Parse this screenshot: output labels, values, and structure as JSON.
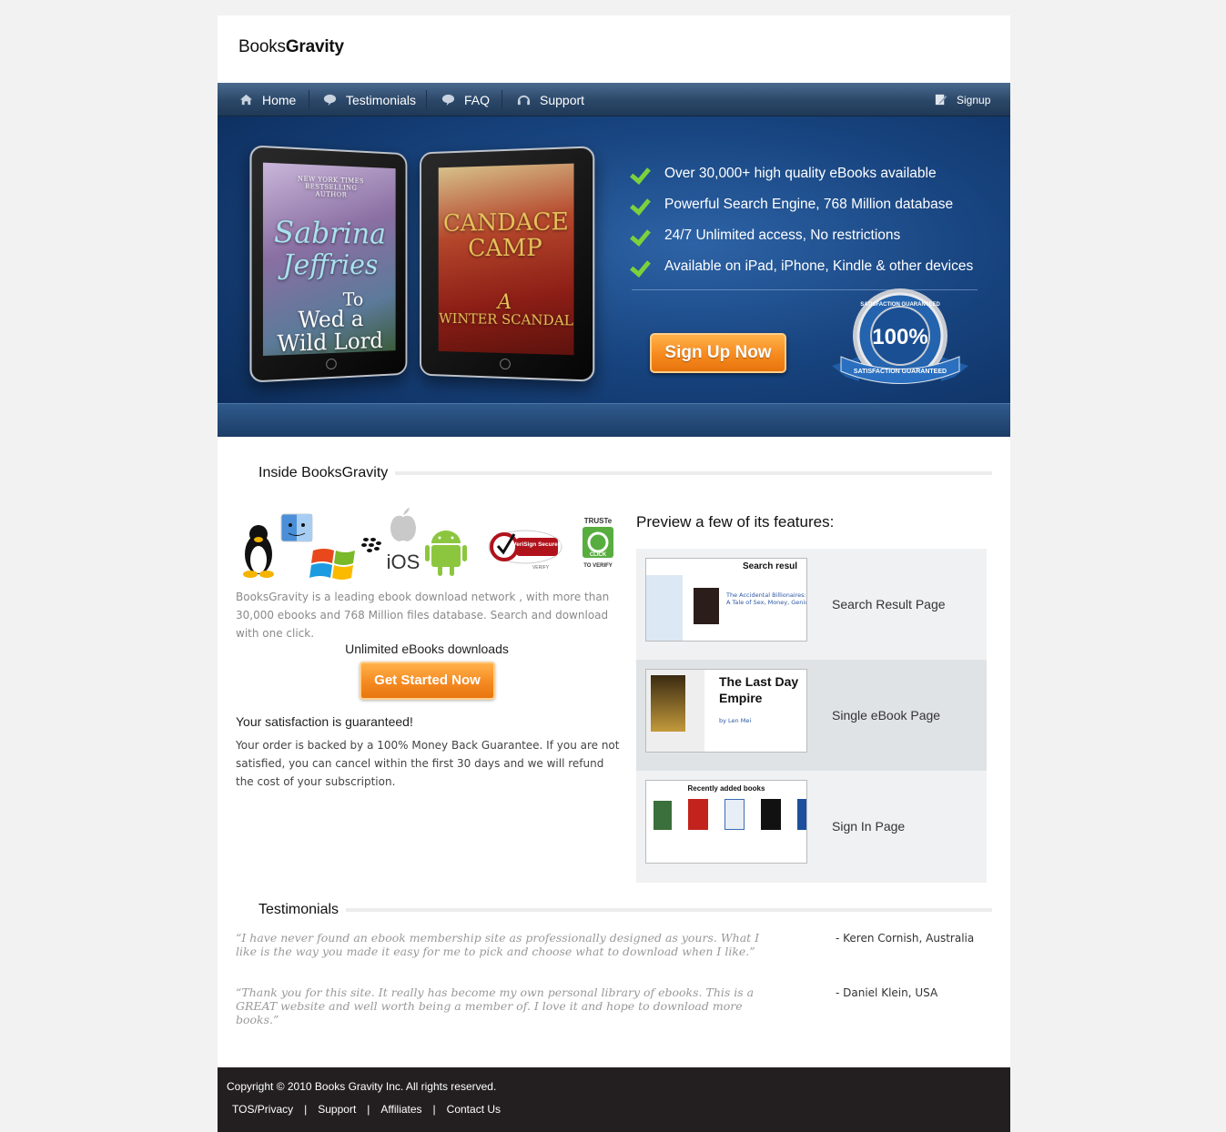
{
  "logo": {
    "light": "Books",
    "bold": "Gravity"
  },
  "nav": {
    "items": [
      {
        "label": "Home",
        "icon": "home-icon"
      },
      {
        "label": "Testimonials",
        "icon": "speech-bubble-icon"
      },
      {
        "label": "FAQ",
        "icon": "speech-bubble-icon"
      },
      {
        "label": "Support",
        "icon": "headset-icon"
      }
    ],
    "signup": {
      "label": "Signup",
      "icon": "pencil-icon"
    }
  },
  "hero": {
    "tablet1": {
      "line1": "Sabrina",
      "line2": "Jeffries",
      "line3": "To",
      "line4": "Wed a",
      "line5": "Wild Lord",
      "tag": "NEW YORK TIMES BESTSELLING AUTHOR"
    },
    "tablet2": {
      "line1": "CANDACE",
      "line2": "CAMP",
      "line3": "A",
      "line4": "WINTER SCANDAL"
    },
    "features": [
      "Over 30,000+ high quality eBooks available",
      "Powerful Search Engine, 768 Million database",
      "24/7 Unlimited access, No restrictions",
      "Available on iPad, iPhone, Kindle & other devices"
    ],
    "signup_button": "Sign Up Now",
    "seal": {
      "top": "SATISFACTION GUARANTEED",
      "big": "100%",
      "ribbon": "SATISFACTION GUARANTEED"
    }
  },
  "inside": {
    "title": "Inside BooksGravity",
    "logos": {
      "ios": "iOS",
      "verisign": "VeriSign Secured",
      "verify": "VERIFY",
      "truste": "TRUSTe",
      "click": "CLICK",
      "to_verify": "TO VERIFY"
    },
    "intro": "BooksGravity is a leading ebook download network , with more than 30,000 ebooks and 768 Million files database. Search and download with one click.",
    "unlimited": "Unlimited eBooks downloads",
    "start_button": "Get Started Now",
    "satisfaction_title": "Your satisfaction is guaranteed!",
    "satisfaction_text": "Your order is backed by a 100% Money Back Guarantee. If you are not satisfied, you can cancel within the first 30 days and we will refund the cost of your subscription."
  },
  "preview": {
    "title": "Preview a few of its features:",
    "items": [
      {
        "label": "Search Result Page",
        "thumb_title": "Search resul",
        "thumb_sub": "The Accidental Billionaires: T A Tale of Sex, Money, Geniu"
      },
      {
        "label": "Single eBook Page",
        "thumb_title": "The Last Day Empire",
        "thumb_sub": "by Len Mei"
      },
      {
        "label": "Sign In Page",
        "thumb_title": "Recently added books",
        "thumb_sub": ""
      }
    ]
  },
  "testimonials": {
    "title": "Testimonials",
    "items": [
      {
        "quote": "“I have never found an ebook membership site as professionally designed as yours. What I like is the way you made it easy for me to pick and choose what to download when I like.”",
        "author": "- Keren Cornish, Australia"
      },
      {
        "quote": "“Thank you for this site. It really has become my own personal library of ebooks. This is a GREAT website and well worth being a member of. I love it and hope to download more books.”",
        "author": "- Daniel Klein, USA"
      }
    ]
  },
  "footer": {
    "copyright": "Copyright © 2010 Books Gravity Inc. All rights reserved.",
    "links": [
      "TOS/Privacy",
      "Support",
      "Affiliates",
      "Contact Us"
    ],
    "separator": "|"
  },
  "colors": {
    "nav": "#2b4768",
    "hero": "#17437e",
    "accent": "#f68a1f",
    "check": "#7bd13c",
    "footer": "#231f20"
  }
}
